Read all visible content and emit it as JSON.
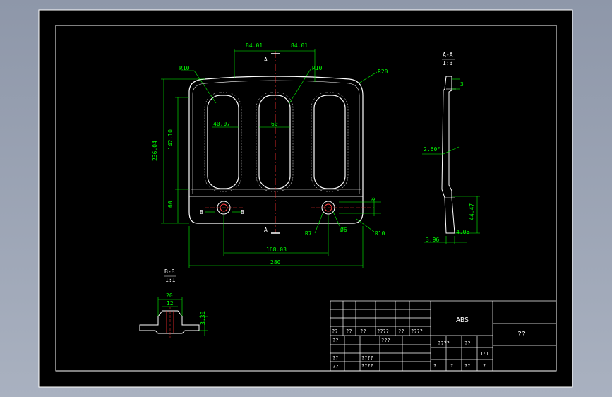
{
  "front_view": {
    "dims": {
      "top_left": "84.01",
      "top_right": "84.01",
      "section_top": "A",
      "section_bottom": "A",
      "r_left": "R10",
      "r_center": "R10",
      "r_corner": "R20",
      "slot_left_width": "40.07",
      "slot_center_width": "60",
      "height_total": "236.04",
      "height_upper": "142.10",
      "height_lower": "60",
      "b_left": "B",
      "b_right": "B",
      "hole_right_label": "8",
      "hole_dia": "Ø6",
      "r_hole": "R7",
      "r_bottom": "R10",
      "hole_spacing": "168.03",
      "width_total": "280"
    }
  },
  "side_view": {
    "dims": {
      "section_label": "A-A",
      "scale": "1:3",
      "top_thickness": "3",
      "angle": "2.60°",
      "lower_height": "44.47",
      "step_a": "4.05",
      "step_b": "3.96"
    }
  },
  "section_view": {
    "dims": {
      "section_label": "B-B",
      "scale": "1:1",
      "outer_width": "20",
      "inner_width": "12",
      "height": "3.30"
    }
  },
  "title_block": {
    "material": "ABS",
    "drawing_name": "??",
    "row_labels": [
      "??",
      "??",
      "??",
      "????",
      "??",
      "????"
    ],
    "designer": "??",
    "checker": "???",
    "approver": "??",
    "date": "????",
    "stage": "????",
    "weight": "??",
    "scale_label": "??",
    "scale_value": "1:1",
    "sheet": [
      "?",
      "?",
      "??",
      "?"
    ]
  }
}
